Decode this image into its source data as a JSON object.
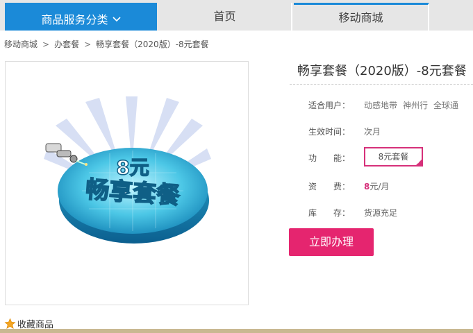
{
  "nav": {
    "category_label": "商品服务分类",
    "home_label": "首页",
    "mall_label": "移动商城"
  },
  "breadcrumb": {
    "items": [
      "移动商城",
      "办套餐",
      "畅享套餐（2020版）-8元套餐"
    ],
    "separator": ">"
  },
  "product": {
    "image_text_top": "8元",
    "image_text_main": "畅享套餐",
    "title": "畅享套餐（2020版）-8元套餐",
    "users_label": "适合用户：",
    "users": [
      "动感地带",
      "神州行",
      "全球通"
    ],
    "effective_label": "生效时间：",
    "effective_value": "次月",
    "function_label": "功　　能：",
    "function_value": "8元套餐",
    "fee_label": "资　　费：",
    "fee_number": "8",
    "fee_unit": "元/月",
    "stock_label": "库　　存：",
    "stock_value": "货源充足",
    "buy_label": "立即办理"
  },
  "favorite": {
    "label": "收藏商品"
  },
  "colors": {
    "nav_active": "#1b8ad8",
    "accent_pink": "#e5256f",
    "plan_border": "#d6307a"
  }
}
